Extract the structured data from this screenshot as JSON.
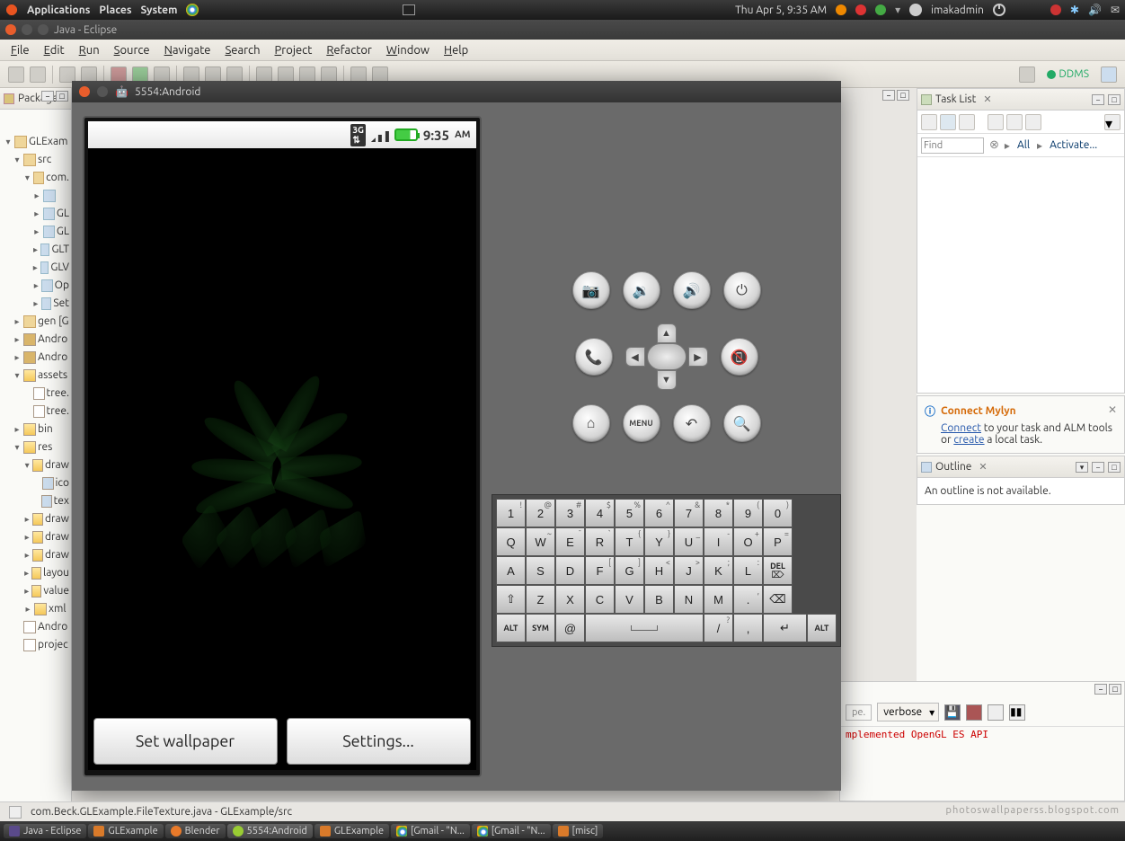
{
  "ubuntu": {
    "apps": "Applications",
    "places": "Places",
    "system": "System",
    "clock": "Thu Apr 5,  9:35 AM",
    "user": "imakadmin"
  },
  "eclipse": {
    "title": "Java - Eclipse",
    "menu": [
      "File",
      "Edit",
      "Run",
      "Source",
      "Navigate",
      "Search",
      "Project",
      "Refactor",
      "Window",
      "Help"
    ],
    "ddms": "DDMS"
  },
  "package_explorer": {
    "title": "Package E",
    "tree": {
      "root": "GLExam",
      "src": "src",
      "pkg": "com.",
      "files": [
        "",
        "GL",
        "GL",
        "GLT",
        "GLV",
        "Op",
        "Set"
      ],
      "gen": "gen [G",
      "andro1": "Andro",
      "andro2": "Andro",
      "assets": "assets",
      "tree1": "tree.",
      "tree2": "tree.",
      "bin": "bin",
      "res": "res",
      "draw1": "draw",
      "ico": "ico",
      "tex": "tex",
      "draw2": "draw",
      "draw3": "draw",
      "draw4": "draw",
      "layout": "layou",
      "values": "value",
      "xml": "xml",
      "andro3": "Andro",
      "project": "projec"
    }
  },
  "tasklist": {
    "title": "Task List",
    "find_ph": "Find",
    "all": "All",
    "activate": "Activate..."
  },
  "mylyn": {
    "title": "Connect Mylyn",
    "connect": "Connect",
    "text1": " to your task and ALM tools or ",
    "create": "create",
    "text2": " a local task."
  },
  "outline": {
    "title": "Outline",
    "body": "An outline is not available."
  },
  "console": {
    "level": "verbose",
    "err": "mplemented OpenGL ES API"
  },
  "status": {
    "path": "com.Beck.GLExample.FileTexture.java - GLExample/src"
  },
  "taskbar": {
    "items": [
      "Java - Eclipse",
      "GLExample",
      "Blender",
      "5554:Android",
      "GLExample",
      "[Gmail - \"N...",
      "[Gmail - \"N...",
      "[misc]"
    ]
  },
  "emulator": {
    "title": "5554:Android",
    "clock": "9:35",
    "ampm": "AM",
    "set_wallpaper": "Set wallpaper",
    "settings": "Settings...",
    "menu_label": "MENU",
    "alt": "ALT",
    "sym": "SYM",
    "del": "DEL",
    "enter": "↵",
    "shift": "⇧",
    "back": "⌫",
    "kb": {
      "r1": [
        [
          "1",
          "!"
        ],
        [
          "2",
          "@"
        ],
        [
          "3",
          "#"
        ],
        [
          "4",
          "$"
        ],
        [
          "5",
          "%"
        ],
        [
          "6",
          "^"
        ],
        [
          "7",
          "&"
        ],
        [
          "8",
          "*"
        ],
        [
          "9",
          "("
        ],
        [
          "0",
          ")"
        ]
      ],
      "r2": [
        [
          "Q",
          ""
        ],
        [
          "W",
          "~"
        ],
        [
          "E",
          "¯"
        ],
        [
          "R",
          "`"
        ],
        [
          "T",
          "{"
        ],
        [
          "Y",
          "}"
        ],
        [
          "U",
          "_"
        ],
        [
          "I",
          "-"
        ],
        [
          "O",
          "+"
        ],
        [
          "P",
          "="
        ]
      ],
      "r3": [
        [
          "A",
          ""
        ],
        [
          "S",
          ""
        ],
        [
          "D",
          ""
        ],
        [
          "F",
          "["
        ],
        [
          "G",
          "]"
        ],
        [
          "H",
          "<"
        ],
        [
          "J",
          ">"
        ],
        [
          "K",
          ";"
        ],
        [
          "L",
          ":"
        ]
      ],
      "r4": [
        [
          "Z",
          ""
        ],
        [
          "X",
          ""
        ],
        [
          "C",
          ""
        ],
        [
          "V",
          ""
        ],
        [
          "B",
          ""
        ],
        [
          "N",
          ""
        ],
        [
          "M",
          ""
        ],
        [
          ".",
          ","
        ]
      ],
      "r5_at": "@",
      "r5_slash": [
        "/",
        "?"
      ],
      "r5_comma": [
        ",",
        ""
      ]
    }
  },
  "watermark": "photoswallpaperss.blogspot.com"
}
